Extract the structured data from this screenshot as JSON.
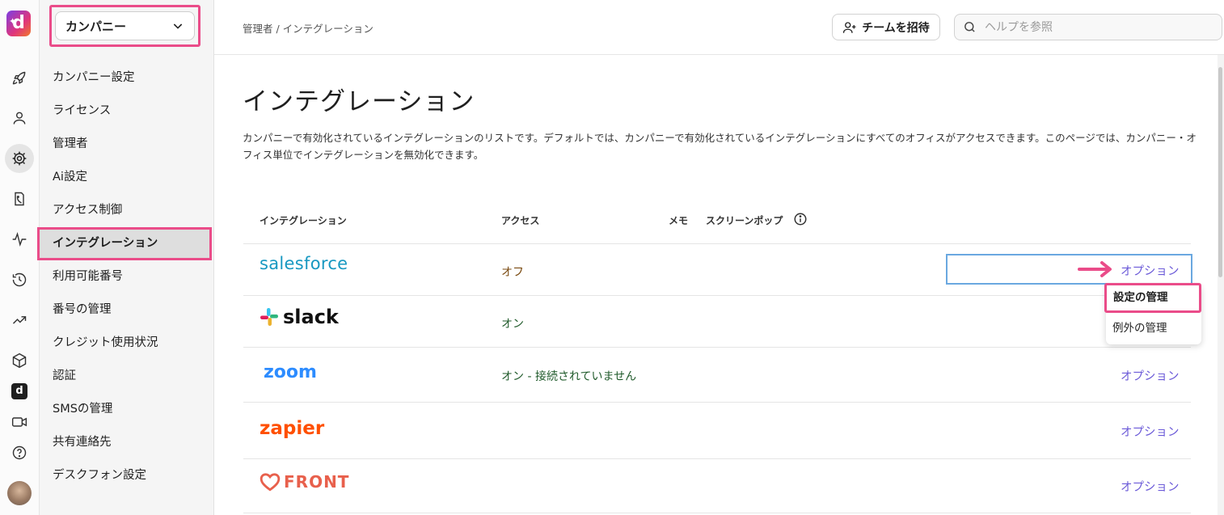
{
  "sidebar": {
    "company_select": "カンパニー",
    "items": [
      {
        "label": "カンパニー設定"
      },
      {
        "label": "ライセンス"
      },
      {
        "label": "管理者"
      },
      {
        "label": "Ai設定"
      },
      {
        "label": "アクセス制御"
      },
      {
        "label": "インテグレーション"
      },
      {
        "label": "利用可能番号"
      },
      {
        "label": "番号の管理"
      },
      {
        "label": "クレジット使用状況"
      },
      {
        "label": "認証"
      },
      {
        "label": "SMSの管理"
      },
      {
        "label": "共有連絡先"
      },
      {
        "label": "デスクフォン設定"
      }
    ]
  },
  "topbar": {
    "breadcrumb": "管理者 / インテグレーション",
    "invite_label": "チームを招待",
    "search_placeholder": "ヘルプを参照"
  },
  "main": {
    "title": "インテグレーション",
    "description": "カンパニーで有効化されているインテグレーションのリストです。デフォルトでは、カンパニーで有効化されているインテグレーションにすべてのオフィスがアクセスできます。このページでは、カンパニー・オフィス単位でインテグレーションを無効化できます。",
    "table": {
      "headers": {
        "integration": "インテグレーション",
        "access": "アクセス",
        "memo": "メモ",
        "screenpop": "スクリーンポップ"
      },
      "rows": [
        {
          "name": "salesforce",
          "access": "オフ",
          "action": "オプション"
        },
        {
          "name": "slack",
          "access": "オン",
          "action": ""
        },
        {
          "name": "zoom",
          "access": "オン - 接続されていません",
          "action": "オプション"
        },
        {
          "name": "zapier",
          "access": "",
          "action": "オプション"
        },
        {
          "name": "FRONT",
          "access": "",
          "action": "オプション"
        }
      ]
    },
    "options_menu": {
      "items": [
        "設定の管理",
        "例外の管理"
      ]
    }
  },
  "colors": {
    "highlight": "#ea4c89",
    "link": "#6b5ad8",
    "salesforce": "#1798c1",
    "zoom": "#2d8cff",
    "zapier": "#ff4f00",
    "front": "#e8604c"
  }
}
